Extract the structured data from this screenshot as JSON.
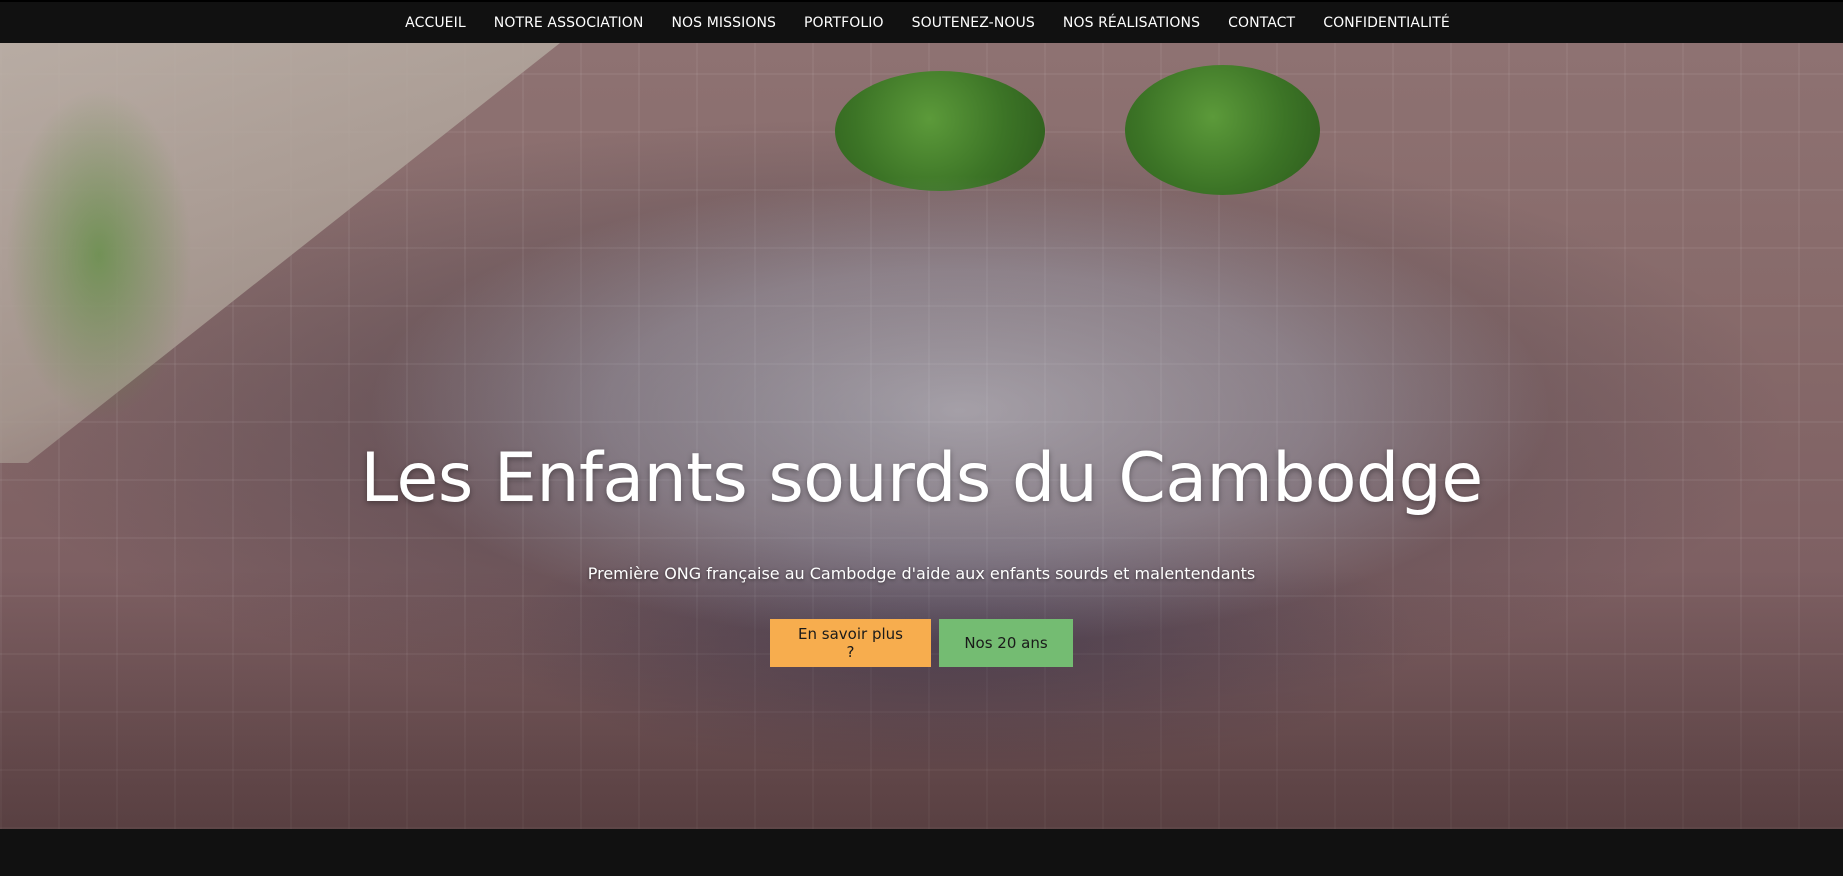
{
  "nav": {
    "items": [
      {
        "label": "ACCUEIL"
      },
      {
        "label": "NOTRE ASSOCIATION"
      },
      {
        "label": "NOS MISSIONS"
      },
      {
        "label": "PORTFOLIO"
      },
      {
        "label": "SOUTENEZ-NOUS"
      },
      {
        "label": "NOS RÉALISATIONS"
      },
      {
        "label": "CONTACT"
      },
      {
        "label": "CONFIDENTIALITÉ"
      }
    ]
  },
  "hero": {
    "title": "Les Enfants sourds du Cambodge",
    "subtitle": "Première ONG française au Cambodge d'aide aux enfants sourds et malentendants",
    "buttons": {
      "learn_more": "En savoir plus ?",
      "anniversary": "Nos 20 ans"
    }
  },
  "colors": {
    "navbar_bg": "#111111",
    "button_orange": "#f7ad4e",
    "button_green": "#74bc72",
    "text_white": "#ffffff"
  }
}
